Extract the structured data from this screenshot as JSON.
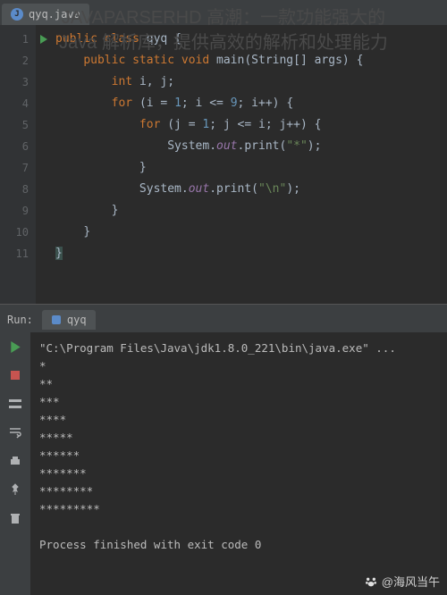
{
  "overlay": {
    "title_line1": "JAVAPARSERHD 高潮：一款功能强大的",
    "title_line2": "Java 解析库，提供高效的解析和处理能力"
  },
  "editor": {
    "filename": "qyq.java",
    "java_badge": "J",
    "gutter_lines": [
      "1",
      "2",
      "3",
      "4",
      "5",
      "6",
      "7",
      "8",
      "9",
      "10",
      "11"
    ],
    "code_lines": [
      {
        "indent": 0,
        "tokens": [
          {
            "t": "public ",
            "c": "kw"
          },
          {
            "t": "class",
            "c": "kw"
          },
          {
            "t": " qyq {",
            "c": "typ"
          }
        ]
      },
      {
        "indent": 1,
        "tokens": [
          {
            "t": "public static void ",
            "c": "kw"
          },
          {
            "t": "main",
            "c": "typ"
          },
          {
            "t": "(String[] args) {",
            "c": "typ"
          }
        ]
      },
      {
        "indent": 2,
        "tokens": [
          {
            "t": "int ",
            "c": "kw"
          },
          {
            "t": "i, j;",
            "c": "typ"
          }
        ]
      },
      {
        "indent": 2,
        "tokens": [
          {
            "t": "for ",
            "c": "kw"
          },
          {
            "t": "(i = ",
            "c": "typ"
          },
          {
            "t": "1",
            "c": "num"
          },
          {
            "t": "; i <= ",
            "c": "typ"
          },
          {
            "t": "9",
            "c": "num"
          },
          {
            "t": "; i++) {",
            "c": "typ"
          }
        ]
      },
      {
        "indent": 3,
        "tokens": [
          {
            "t": "for ",
            "c": "kw"
          },
          {
            "t": "(j = ",
            "c": "typ"
          },
          {
            "t": "1",
            "c": "num"
          },
          {
            "t": "; j <= i; j++) {",
            "c": "typ"
          }
        ]
      },
      {
        "indent": 4,
        "tokens": [
          {
            "t": "System.",
            "c": "typ"
          },
          {
            "t": "out",
            "c": "fld"
          },
          {
            "t": ".print(",
            "c": "typ"
          },
          {
            "t": "\"*\"",
            "c": "str"
          },
          {
            "t": ");",
            "c": "typ"
          }
        ]
      },
      {
        "indent": 3,
        "tokens": [
          {
            "t": "}",
            "c": "typ"
          }
        ]
      },
      {
        "indent": 3,
        "tokens": [
          {
            "t": "System.",
            "c": "typ"
          },
          {
            "t": "out",
            "c": "fld"
          },
          {
            "t": ".print(",
            "c": "typ"
          },
          {
            "t": "\"\\n\"",
            "c": "str"
          },
          {
            "t": ");",
            "c": "typ"
          }
        ]
      },
      {
        "indent": 2,
        "tokens": [
          {
            "t": "}",
            "c": "typ"
          }
        ]
      },
      {
        "indent": 1,
        "tokens": [
          {
            "t": "}",
            "c": "typ"
          }
        ]
      },
      {
        "indent": 0,
        "tokens": [
          {
            "t": "}",
            "c": "typ brace-hl"
          }
        ]
      }
    ]
  },
  "run": {
    "label": "Run:",
    "tab_name": "qyq",
    "command": "\"C:\\Program Files\\Java\\jdk1.8.0_221\\bin\\java.exe\" ...",
    "output": [
      "*",
      "**",
      "***",
      "****",
      "*****",
      "******",
      "*******",
      "********",
      "*********"
    ],
    "exit": "Process finished with exit code 0"
  },
  "watermark": "@海风当午"
}
